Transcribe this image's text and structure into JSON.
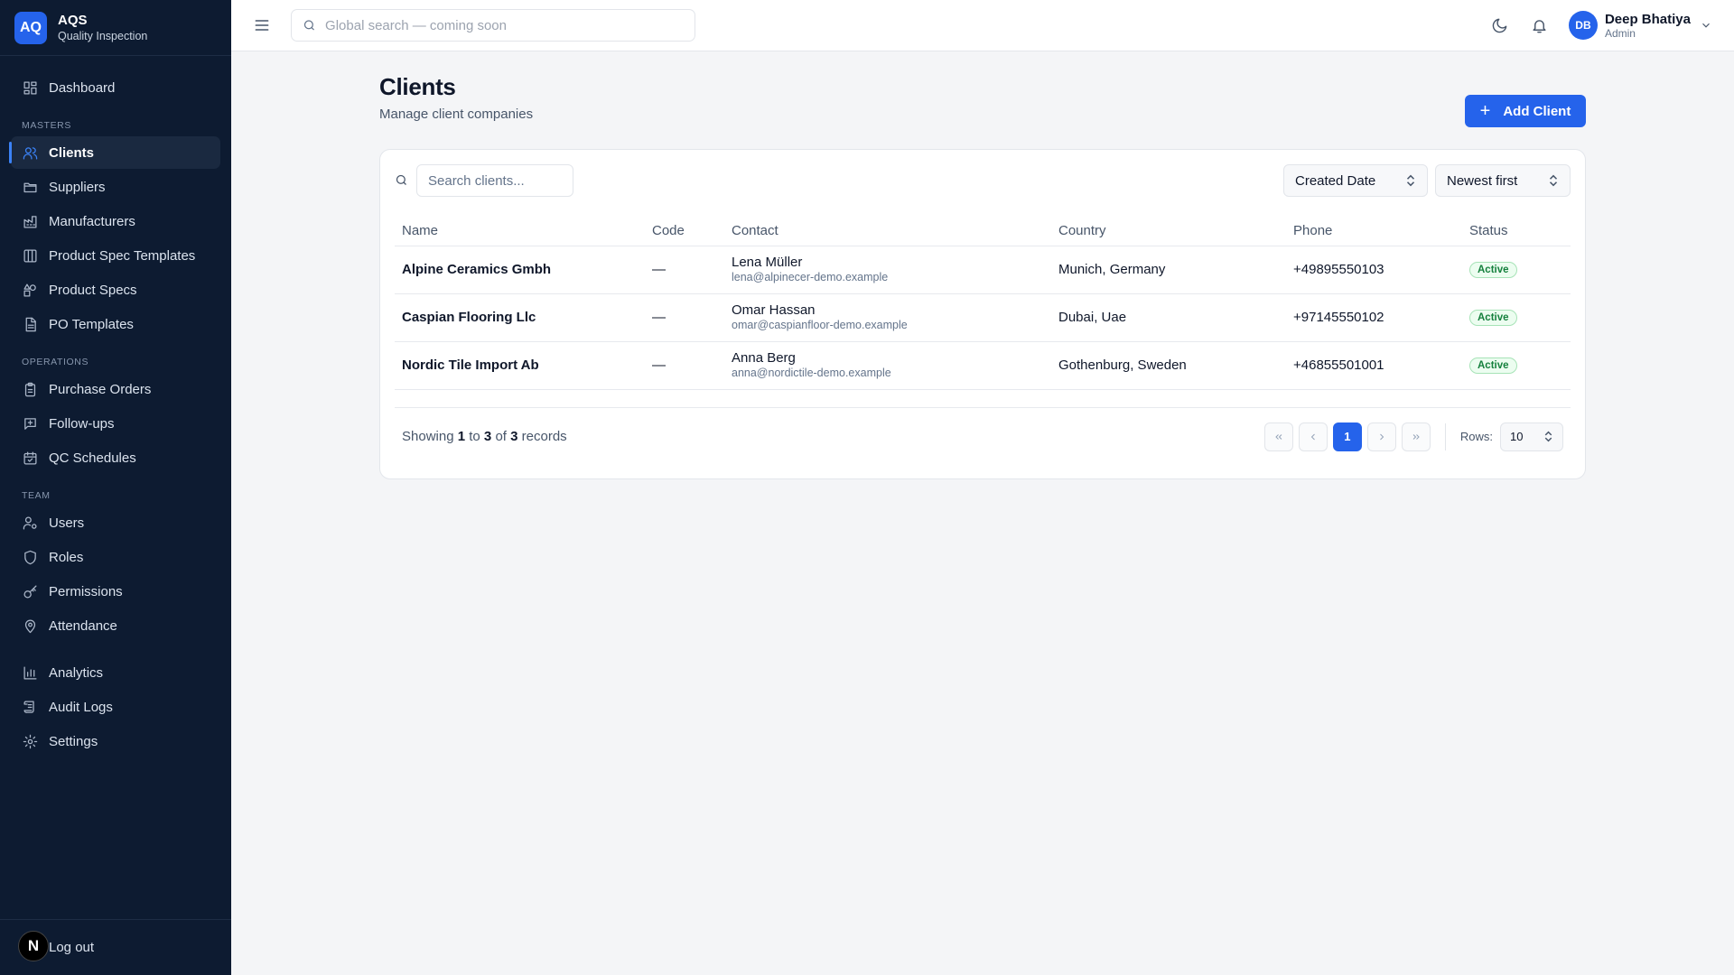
{
  "brand": {
    "logo": "AQ",
    "name": "AQS",
    "subtitle": "Quality Inspection"
  },
  "sidebar": {
    "top_items": [
      {
        "label": "Dashboard",
        "icon": "dashboard-icon"
      }
    ],
    "sections": [
      {
        "title": "MASTERS",
        "items": [
          {
            "label": "Clients",
            "icon": "users-icon",
            "active": true
          },
          {
            "label": "Suppliers",
            "icon": "folder-icon"
          },
          {
            "label": "Manufacturers",
            "icon": "factory-icon"
          },
          {
            "label": "Product Spec Templates",
            "icon": "columns-icon"
          },
          {
            "label": "Product Specs",
            "icon": "shapes-icon"
          },
          {
            "label": "PO Templates",
            "icon": "file-icon"
          }
        ]
      },
      {
        "title": "OPERATIONS",
        "items": [
          {
            "label": "Purchase Orders",
            "icon": "clipboard-icon"
          },
          {
            "label": "Follow-ups",
            "icon": "message-plus-icon"
          },
          {
            "label": "QC Schedules",
            "icon": "calendar-check-icon"
          }
        ]
      },
      {
        "title": "TEAM",
        "items": [
          {
            "label": "Users",
            "icon": "user-cog-icon"
          },
          {
            "label": "Roles",
            "icon": "shield-icon"
          },
          {
            "label": "Permissions",
            "icon": "key-icon"
          },
          {
            "label": "Attendance",
            "icon": "map-pin-icon"
          }
        ]
      }
    ],
    "bottom_items": [
      {
        "label": "Analytics",
        "icon": "bar-chart-icon"
      },
      {
        "label": "Audit Logs",
        "icon": "scroll-icon"
      },
      {
        "label": "Settings",
        "icon": "gear-icon"
      }
    ],
    "footer": {
      "badge": "N",
      "logout_label": "Log out"
    }
  },
  "topbar": {
    "search_placeholder": "Global search — coming soon",
    "user": {
      "initials": "DB",
      "name": "Deep Bhatiya",
      "role": "Admin"
    }
  },
  "page": {
    "title": "Clients",
    "subtitle": "Manage client companies",
    "add_button": "Add Client"
  },
  "toolbar": {
    "search_placeholder": "Search clients...",
    "sort_field": "Created Date",
    "sort_order": "Newest first"
  },
  "table": {
    "columns": [
      "Name",
      "Code",
      "Contact",
      "Country",
      "Phone",
      "Status"
    ],
    "rows": [
      {
        "name": "Alpine Ceramics Gmbh",
        "code": "—",
        "contact_name": "Lena Müller",
        "contact_email": "lena@alpinecer-demo.example",
        "country": "Munich, Germany",
        "phone": "+49895550103",
        "status": "Active"
      },
      {
        "name": "Caspian Flooring Llc",
        "code": "—",
        "contact_name": "Omar Hassan",
        "contact_email": "omar@caspianfloor-demo.example",
        "country": "Dubai, Uae",
        "phone": "+97145550102",
        "status": "Active"
      },
      {
        "name": "Nordic Tile Import Ab",
        "code": "—",
        "contact_name": "Anna Berg",
        "contact_email": "anna@nordictile-demo.example",
        "country": "Gothenburg, Sweden",
        "phone": "+46855501001",
        "status": "Active"
      }
    ]
  },
  "pagination": {
    "showing_prefix": "Showing",
    "from": "1",
    "to_word": "to",
    "to": "3",
    "of_word": "of",
    "total": "3",
    "records_word": "records",
    "current_page": "1",
    "rows_label": "Rows:",
    "rows_value": "10"
  },
  "colors": {
    "accent": "#2563eb",
    "sidebar_bg": "#0d1b31",
    "status_active": "#15803d"
  }
}
